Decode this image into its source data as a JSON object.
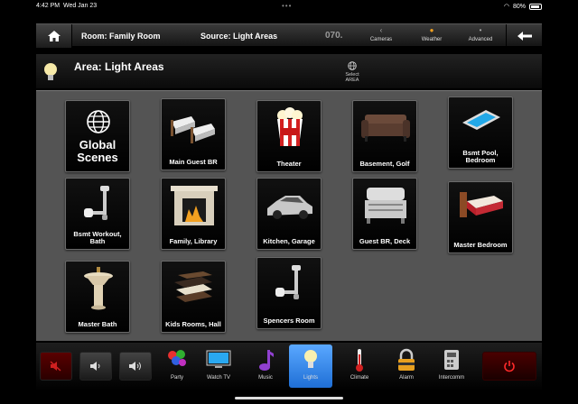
{
  "status": {
    "time": "4:42 PM",
    "date": "Wed Jan 23",
    "battery": "80%",
    "dots": "•••"
  },
  "topbar": {
    "room": "Room: Family Room",
    "source": "Source: Light Areas",
    "code": "070.",
    "buttons": [
      {
        "label": "Cameras",
        "icon": "camera-icon"
      },
      {
        "label": "Weather",
        "icon": "sun-icon"
      },
      {
        "label": "Advanced",
        "icon": "dot-icon"
      }
    ]
  },
  "area": {
    "title": "Area: Light Areas",
    "select_line1": "Select",
    "select_line2": "AREA"
  },
  "tiles": [
    {
      "label": "Global Scenes",
      "icon": "globe-icon"
    },
    {
      "label": "Main Guest BR",
      "icon": "twin-beds-icon"
    },
    {
      "label": "Theater",
      "icon": "popcorn-icon"
    },
    {
      "label": "Basement, Golf",
      "icon": "sofa-icon"
    },
    {
      "label": "Bsmt Pool, Bedroom",
      "icon": "pool-icon"
    },
    {
      "label": "Bsmt Workout, Bath",
      "icon": "light-fixture-icon"
    },
    {
      "label": "Family, Library",
      "icon": "fireplace-icon"
    },
    {
      "label": "Kitchen, Garage",
      "icon": "car-icon"
    },
    {
      "label": "Guest BR, Deck",
      "icon": "grill-icon"
    },
    {
      "label": "Master Bedroom",
      "icon": "bed-icon"
    },
    {
      "label": "Master Bath",
      "icon": "sink-icon"
    },
    {
      "label": "Kids Rooms, Hall",
      "icon": "books-icon"
    },
    {
      "label": "Spencers Room",
      "icon": "light-fixture-icon"
    }
  ],
  "bottom": {
    "nav": [
      {
        "label": "Party",
        "icon": "balloons-icon"
      },
      {
        "label": "Watch TV",
        "icon": "tv-icon"
      },
      {
        "label": "Music",
        "icon": "music-note-icon"
      },
      {
        "label": "Lights",
        "icon": "lightbulb-icon",
        "selected": true
      },
      {
        "label": "Climate",
        "icon": "thermometer-icon"
      },
      {
        "label": "Alarm",
        "icon": "lock-icon"
      },
      {
        "label": "Intercomm",
        "icon": "intercom-icon"
      }
    ]
  },
  "colors": {
    "panel": "#545454",
    "accent": "#2f86ea",
    "power": "#e02020",
    "mute": "#cc2222"
  }
}
